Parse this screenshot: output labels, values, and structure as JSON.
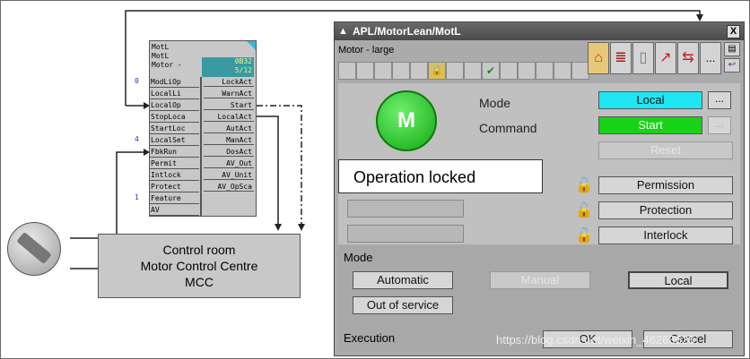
{
  "diagram": {
    "function_block": {
      "header": [
        "MotL",
        "MotL",
        "Motor -"
      ],
      "display": [
        "0B32",
        "5/12"
      ],
      "inputs": [
        "ModLiOp",
        "LocalLi",
        "LocalOp",
        "StopLoca",
        "StartLoc",
        "LocalSet",
        "FbkRun",
        "Permit",
        "Intlock",
        "Protect",
        "Feature",
        "AV"
      ],
      "outputs": [
        "LockAct",
        "WarnAct",
        "Start",
        "LocalAct",
        "AutAct",
        "ManAct",
        "OosAct",
        "AV_Out",
        "AV_Unit",
        "AV_OpSca"
      ],
      "pin_numbers": {
        "modliop": "0",
        "localset": "4",
        "feature": "1"
      }
    },
    "mcc_box": {
      "line1": "Control room",
      "line2": "Motor Control Centre",
      "line3": "MCC"
    }
  },
  "faceplate": {
    "title": "APL/MotorLean/MotL",
    "close_label": "X",
    "motor_label": "Motor - large",
    "status_symbol": "M",
    "mode_label": "Mode",
    "command_label": "Command",
    "mode_value": "Local",
    "command_value": "Start",
    "reset_label": "Reset",
    "more_label": "...",
    "permission_label": "Permission",
    "protection_label": "Protection",
    "interlock_label": "Interlock",
    "mode_section_title": "Mode",
    "automatic_label": "Automatic",
    "manual_label": "Manual",
    "local_label": "Local",
    "out_of_service_label": "Out of service",
    "execution_title": "Execution",
    "ok_label": "OK",
    "cancel_label": "Cancel",
    "nav_more": "..."
  },
  "callout": {
    "text": "Operation locked"
  },
  "watermark": {
    "text": "https://blog.csdn.net/weixin_46263626"
  },
  "colors": {
    "mode_active": "#1ee6f2",
    "command_active": "#18d218",
    "status_green": "#18c818"
  }
}
